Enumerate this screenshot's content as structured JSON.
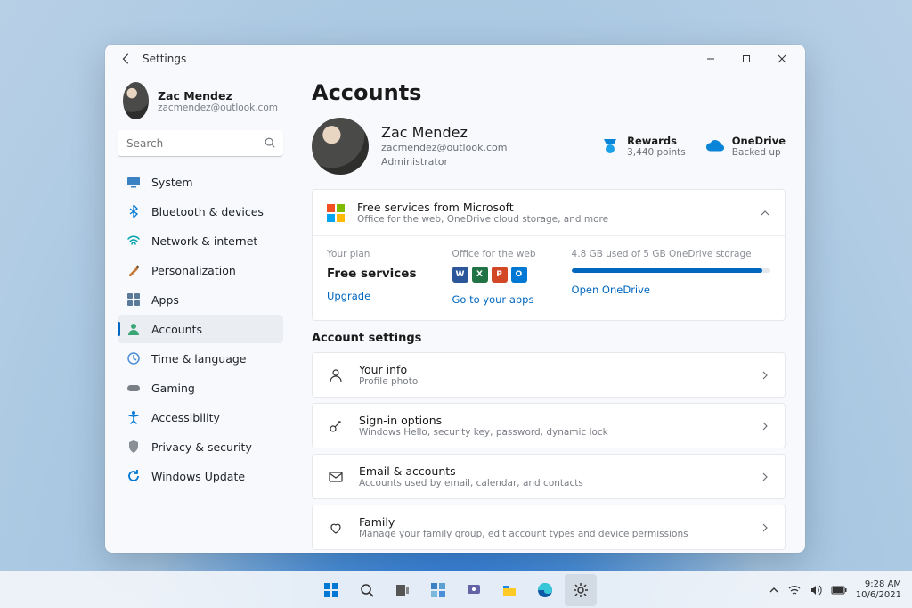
{
  "window": {
    "title": "Settings"
  },
  "user": {
    "name": "Zac Mendez",
    "email": "zacmendez@outlook.com",
    "role": "Administrator"
  },
  "search": {
    "placeholder": "Search"
  },
  "nav": {
    "items": [
      {
        "label": "System"
      },
      {
        "label": "Bluetooth & devices"
      },
      {
        "label": "Network & internet"
      },
      {
        "label": "Personalization"
      },
      {
        "label": "Apps"
      },
      {
        "label": "Accounts"
      },
      {
        "label": "Time & language"
      },
      {
        "label": "Gaming"
      },
      {
        "label": "Accessibility"
      },
      {
        "label": "Privacy & security"
      },
      {
        "label": "Windows Update"
      }
    ]
  },
  "page": {
    "heading": "Accounts",
    "rewards": {
      "label": "Rewards",
      "sub": "3,440 points"
    },
    "onedrive": {
      "label": "OneDrive",
      "sub": "Backed up"
    },
    "services": {
      "title": "Free services from Microsoft",
      "sub": "Office for the web, OneDrive cloud storage, and more",
      "plan_label": "Your plan",
      "plan_name": "Free services",
      "upgrade": "Upgrade",
      "office_label": "Office for the web",
      "go_apps": "Go to your apps",
      "storage_label": "4.8 GB used of 5 GB OneDrive storage",
      "storage_pct": 96,
      "open_onedrive": "Open OneDrive"
    },
    "settings_h": "Account settings",
    "rows": [
      {
        "title": "Your info",
        "sub": "Profile photo"
      },
      {
        "title": "Sign-in options",
        "sub": "Windows Hello, security key, password, dynamic lock"
      },
      {
        "title": "Email & accounts",
        "sub": "Accounts used by email, calendar, and contacts"
      },
      {
        "title": "Family",
        "sub": "Manage your family group, edit account types and device permissions"
      }
    ]
  },
  "taskbar": {
    "time": "9:28 AM",
    "date": "10/6/2021"
  }
}
